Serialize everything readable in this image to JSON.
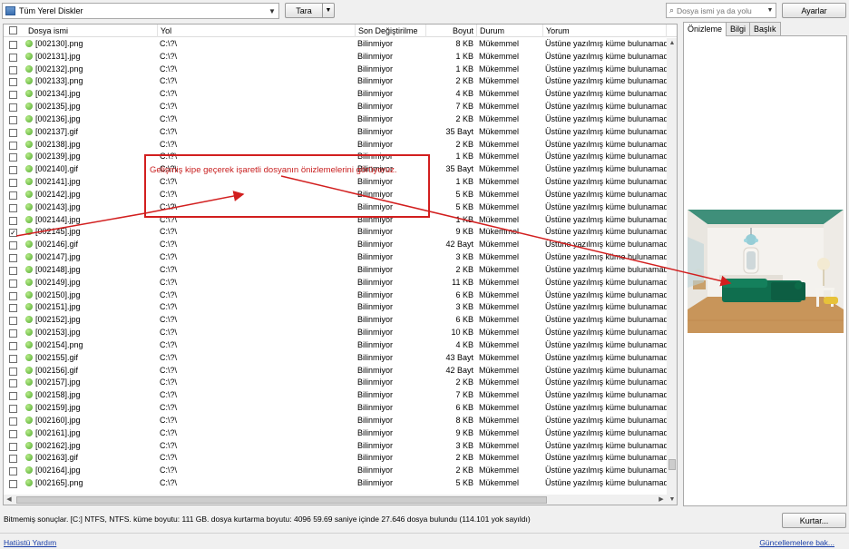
{
  "toolbar": {
    "drive_select": "Tüm Yerel Diskler",
    "scan_button": "Tara",
    "search_placeholder": "Dosya ismi ya da yolu",
    "settings_button": "Ayarlar"
  },
  "table": {
    "columns": [
      "Dosya ismi",
      "Yol",
      "Son Değiştirilme",
      "Boyut",
      "Durum",
      "Yorum"
    ],
    "rows": [
      {
        "name": "[002130].png",
        "path": "C:\\?\\",
        "date": "Bilinmiyor",
        "size": "8 KB",
        "state": "Mükemmel",
        "comment": "Üstüne yazılmış küme bulunamadı",
        "checked": false
      },
      {
        "name": "[002131].jpg",
        "path": "C:\\?\\",
        "date": "Bilinmiyor",
        "size": "1 KB",
        "state": "Mükemmel",
        "comment": "Üstüne yazılmış küme bulunamadı",
        "checked": false
      },
      {
        "name": "[002132].png",
        "path": "C:\\?\\",
        "date": "Bilinmiyor",
        "size": "1 KB",
        "state": "Mükemmel",
        "comment": "Üstüne yazılmış küme bulunamadı",
        "checked": false
      },
      {
        "name": "[002133].png",
        "path": "C:\\?\\",
        "date": "Bilinmiyor",
        "size": "2 KB",
        "state": "Mükemmel",
        "comment": "Üstüne yazılmış küme bulunamadı",
        "checked": false
      },
      {
        "name": "[002134].jpg",
        "path": "C:\\?\\",
        "date": "Bilinmiyor",
        "size": "4 KB",
        "state": "Mükemmel",
        "comment": "Üstüne yazılmış küme bulunamadı",
        "checked": false
      },
      {
        "name": "[002135].jpg",
        "path": "C:\\?\\",
        "date": "Bilinmiyor",
        "size": "7 KB",
        "state": "Mükemmel",
        "comment": "Üstüne yazılmış küme bulunamadı",
        "checked": false
      },
      {
        "name": "[002136].jpg",
        "path": "C:\\?\\",
        "date": "Bilinmiyor",
        "size": "2 KB",
        "state": "Mükemmel",
        "comment": "Üstüne yazılmış küme bulunamadı",
        "checked": false
      },
      {
        "name": "[002137].gif",
        "path": "C:\\?\\",
        "date": "Bilinmiyor",
        "size": "35 Bayt",
        "state": "Mükemmel",
        "comment": "Üstüne yazılmış küme bulunamadı",
        "checked": false
      },
      {
        "name": "[002138].jpg",
        "path": "C:\\?\\",
        "date": "Bilinmiyor",
        "size": "2 KB",
        "state": "Mükemmel",
        "comment": "Üstüne yazılmış küme bulunamadı",
        "checked": false
      },
      {
        "name": "[002139].jpg",
        "path": "C:\\?\\",
        "date": "Bilinmiyor",
        "size": "1 KB",
        "state": "Mükemmel",
        "comment": "Üstüne yazılmış küme bulunamadı",
        "checked": false
      },
      {
        "name": "[002140].gif",
        "path": "C:\\?\\",
        "date": "Bilinmiyor",
        "size": "35 Bayt",
        "state": "Mükemmel",
        "comment": "Üstüne yazılmış küme bulunamadı",
        "checked": false
      },
      {
        "name": "[002141].jpg",
        "path": "C:\\?\\",
        "date": "Bilinmiyor",
        "size": "1 KB",
        "state": "Mükemmel",
        "comment": "Üstüne yazılmış küme bulunamadı",
        "checked": false
      },
      {
        "name": "[002142].jpg",
        "path": "C:\\?\\",
        "date": "Bilinmiyor",
        "size": "5 KB",
        "state": "Mükemmel",
        "comment": "Üstüne yazılmış küme bulunamadı",
        "checked": false
      },
      {
        "name": "[002143].jpg",
        "path": "C:\\?\\",
        "date": "Bilinmiyor",
        "size": "5 KB",
        "state": "Mükemmel",
        "comment": "Üstüne yazılmış küme bulunamadı",
        "checked": false
      },
      {
        "name": "[002144].jpg",
        "path": "C:\\?\\",
        "date": "Bilinmiyor",
        "size": "1 KB",
        "state": "Mükemmel",
        "comment": "Üstüne yazılmış küme bulunamadı",
        "checked": false
      },
      {
        "name": "[002145].jpg",
        "path": "C:\\?\\",
        "date": "Bilinmiyor",
        "size": "9 KB",
        "state": "Mükemmel",
        "comment": "Üstüne yazılmış küme bulunamadı",
        "checked": true
      },
      {
        "name": "[002146].gif",
        "path": "C:\\?\\",
        "date": "Bilinmiyor",
        "size": "42 Bayt",
        "state": "Mükemmel",
        "comment": "Üstüne yazılmış küme bulunamadı",
        "checked": false
      },
      {
        "name": "[002147].jpg",
        "path": "C:\\?\\",
        "date": "Bilinmiyor",
        "size": "3 KB",
        "state": "Mükemmel",
        "comment": "Üstüne yazılmış küme bulunamadı",
        "checked": false
      },
      {
        "name": "[002148].jpg",
        "path": "C:\\?\\",
        "date": "Bilinmiyor",
        "size": "2 KB",
        "state": "Mükemmel",
        "comment": "Üstüne yazılmış küme bulunamadı",
        "checked": false
      },
      {
        "name": "[002149].jpg",
        "path": "C:\\?\\",
        "date": "Bilinmiyor",
        "size": "11 KB",
        "state": "Mükemmel",
        "comment": "Üstüne yazılmış küme bulunamadı",
        "checked": false
      },
      {
        "name": "[002150].jpg",
        "path": "C:\\?\\",
        "date": "Bilinmiyor",
        "size": "6 KB",
        "state": "Mükemmel",
        "comment": "Üstüne yazılmış küme bulunamadı",
        "checked": false
      },
      {
        "name": "[002151].jpg",
        "path": "C:\\?\\",
        "date": "Bilinmiyor",
        "size": "3 KB",
        "state": "Mükemmel",
        "comment": "Üstüne yazılmış küme bulunamadı",
        "checked": false
      },
      {
        "name": "[002152].jpg",
        "path": "C:\\?\\",
        "date": "Bilinmiyor",
        "size": "6 KB",
        "state": "Mükemmel",
        "comment": "Üstüne yazılmış küme bulunamadı",
        "checked": false
      },
      {
        "name": "[002153].jpg",
        "path": "C:\\?\\",
        "date": "Bilinmiyor",
        "size": "10 KB",
        "state": "Mükemmel",
        "comment": "Üstüne yazılmış küme bulunamadı",
        "checked": false
      },
      {
        "name": "[002154].png",
        "path": "C:\\?\\",
        "date": "Bilinmiyor",
        "size": "4 KB",
        "state": "Mükemmel",
        "comment": "Üstüne yazılmış küme bulunamadı",
        "checked": false
      },
      {
        "name": "[002155].gif",
        "path": "C:\\?\\",
        "date": "Bilinmiyor",
        "size": "43 Bayt",
        "state": "Mükemmel",
        "comment": "Üstüne yazılmış küme bulunamadı",
        "checked": false
      },
      {
        "name": "[002156].gif",
        "path": "C:\\?\\",
        "date": "Bilinmiyor",
        "size": "42 Bayt",
        "state": "Mükemmel",
        "comment": "Üstüne yazılmış küme bulunamadı",
        "checked": false
      },
      {
        "name": "[002157].jpg",
        "path": "C:\\?\\",
        "date": "Bilinmiyor",
        "size": "2 KB",
        "state": "Mükemmel",
        "comment": "Üstüne yazılmış küme bulunamadı",
        "checked": false
      },
      {
        "name": "[002158].jpg",
        "path": "C:\\?\\",
        "date": "Bilinmiyor",
        "size": "7 KB",
        "state": "Mükemmel",
        "comment": "Üstüne yazılmış küme bulunamadı",
        "checked": false
      },
      {
        "name": "[002159].jpg",
        "path": "C:\\?\\",
        "date": "Bilinmiyor",
        "size": "6 KB",
        "state": "Mükemmel",
        "comment": "Üstüne yazılmış küme bulunamadı",
        "checked": false
      },
      {
        "name": "[002160].jpg",
        "path": "C:\\?\\",
        "date": "Bilinmiyor",
        "size": "8 KB",
        "state": "Mükemmel",
        "comment": "Üstüne yazılmış küme bulunamadı",
        "checked": false
      },
      {
        "name": "[002161].jpg",
        "path": "C:\\?\\",
        "date": "Bilinmiyor",
        "size": "9 KB",
        "state": "Mükemmel",
        "comment": "Üstüne yazılmış küme bulunamadı",
        "checked": false
      },
      {
        "name": "[002162].jpg",
        "path": "C:\\?\\",
        "date": "Bilinmiyor",
        "size": "3 KB",
        "state": "Mükemmel",
        "comment": "Üstüne yazılmış küme bulunamadı",
        "checked": false
      },
      {
        "name": "[002163].gif",
        "path": "C:\\?\\",
        "date": "Bilinmiyor",
        "size": "2 KB",
        "state": "Mükemmel",
        "comment": "Üstüne yazılmış küme bulunamadı",
        "checked": false
      },
      {
        "name": "[002164].jpg",
        "path": "C:\\?\\",
        "date": "Bilinmiyor",
        "size": "2 KB",
        "state": "Mükemmel",
        "comment": "Üstüne yazılmış küme bulunamadı",
        "checked": false
      },
      {
        "name": "[002165].png",
        "path": "C:\\?\\",
        "date": "Bilinmiyor",
        "size": "5 KB",
        "state": "Mükemmel",
        "comment": "Üstüne yazılmış küme bulunamadı",
        "checked": false
      }
    ]
  },
  "preview": {
    "tabs": [
      "Önizleme",
      "Bilgi",
      "Başlık"
    ],
    "active_tab": "Önizleme"
  },
  "annotation": {
    "text": "Gelişmiş kipe geçerek işaretli dosyanın önizlemelerini görüyoruz."
  },
  "status": {
    "text": "Bitmemiş sonuçlar. [C:] NTFS, NTFS. küme boyutu: 111 GB. dosya kurtarma boyutu: 4096 59.69 saniye içinde 27.646 dosya bulundu (114.101 yok sayıldı)",
    "recover_button": "Kurtar..."
  },
  "footer": {
    "help_link": "Hatüstü Yardım",
    "update_link": "Güncellemelere bak..."
  },
  "colors": {
    "annotation_red": "#d21f1f",
    "status_green": "#4fa82c",
    "link_blue": "#1a3fa8"
  }
}
